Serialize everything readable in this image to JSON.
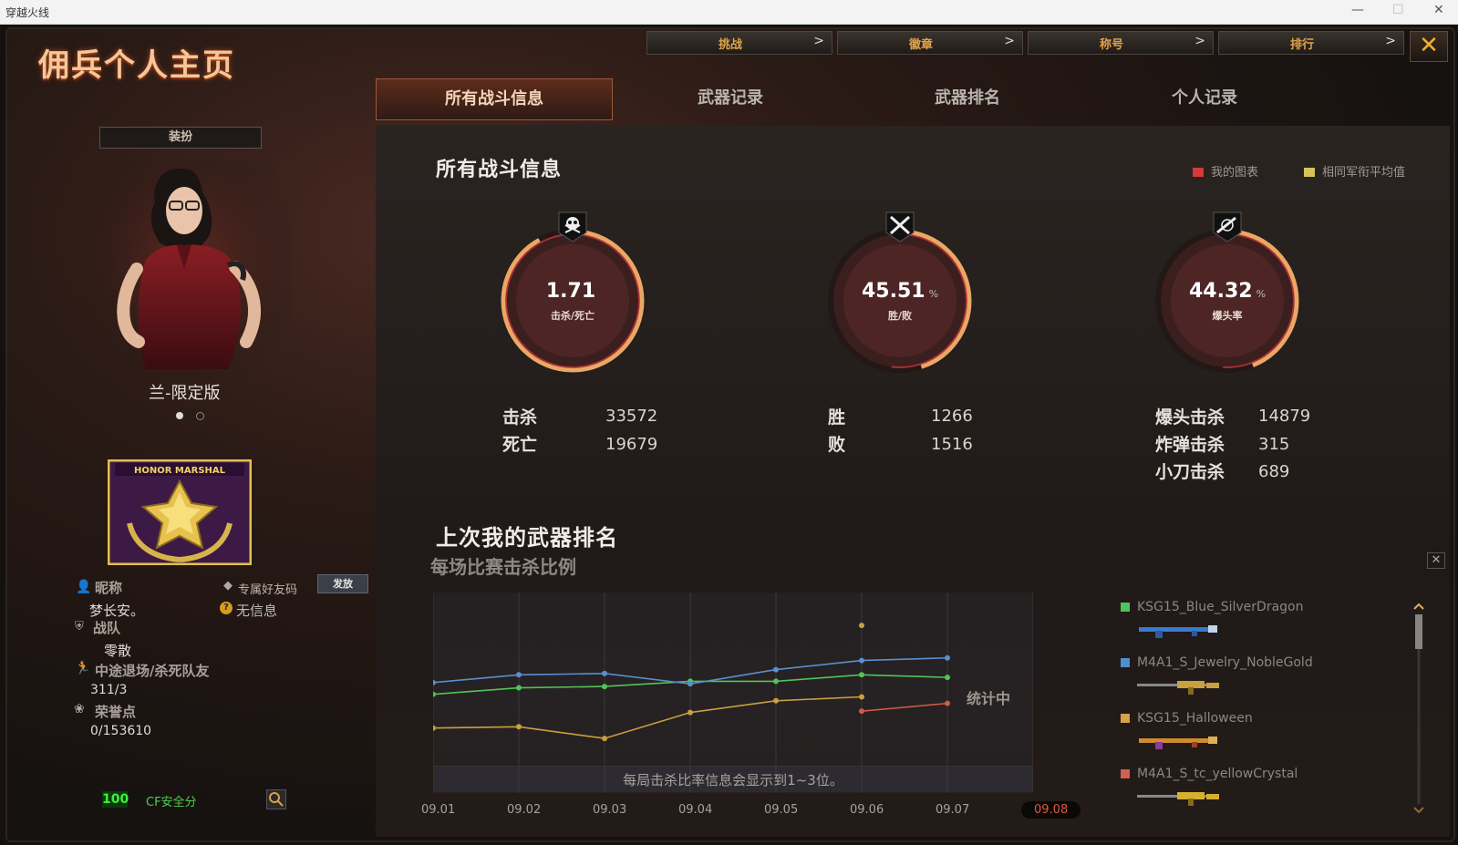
{
  "window": {
    "title": "穿越火线"
  },
  "page_title": "佣兵个人主页",
  "top_nav": [
    {
      "label": "挑战",
      "arrow": ">"
    },
    {
      "label": "徽章",
      "arrow": ">"
    },
    {
      "label": "称号",
      "arrow": ">"
    },
    {
      "label": "排行",
      "arrow": ">"
    }
  ],
  "close_icon": "✕",
  "tabs": [
    {
      "label": "所有战斗信息",
      "active": true
    },
    {
      "label": "武器记录",
      "active": false
    },
    {
      "label": "武器排名",
      "active": false
    },
    {
      "label": "个人记录",
      "active": false
    }
  ],
  "left": {
    "dress_button": "装扮",
    "character_name": "兰-限定版",
    "rank_badge_text": "HONOR MARSHAL",
    "nickname_label": "昵称",
    "nickname": "梦长安。",
    "friend_code_label": "专属好友码",
    "send_button": "发放",
    "no_info": "无信息",
    "team_label": "战队",
    "team": "零散",
    "quit_label": "中途退场/杀死队友",
    "quit_value": "311/3",
    "honor_label": "荣誉点",
    "honor_value": "0/153610",
    "safety_score": "100",
    "safety_label": "CF安全分"
  },
  "main": {
    "section_title": "所有战斗信息",
    "legend_mine": "我的图表",
    "legend_avg": "相同军衔平均值",
    "legend_mine_color": "#d7383a",
    "legend_avg_color": "#d6c25a",
    "gauges": [
      {
        "value": "1.71",
        "unit": "",
        "label": "击杀/死亡",
        "fill": 0.92,
        "icon": "skull-icon"
      },
      {
        "value": "45.51",
        "unit": "%",
        "label": "胜/败",
        "fill": 0.45,
        "icon": "crossed-swords-icon"
      },
      {
        "value": "44.32",
        "unit": "%",
        "label": "爆头率",
        "fill": 0.44,
        "icon": "rifle-icon"
      }
    ],
    "stats": {
      "kills_label": "击杀",
      "kills": "33572",
      "deaths_label": "死亡",
      "deaths": "19679",
      "wins_label": "胜",
      "wins": "1266",
      "losses_label": "败",
      "losses": "1516",
      "headshot_label": "爆头击杀",
      "headshot": "14879",
      "bomb_label": "炸弹击杀",
      "bomb": "315",
      "knife_label": "小刀击杀",
      "knife": "689"
    },
    "ranking_title": "上次我的武器排名",
    "ranking_sub": "每场比赛击杀比例",
    "chart_status": "统计中",
    "chart_note": "每局击杀比率信息会显示到1~3位。",
    "weapons": [
      {
        "name": "KSG15_Blue_SilverDragon",
        "color": "#4fc45a"
      },
      {
        "name": "M4A1_S_Jewelry_NobleGold",
        "color": "#4f8fd0"
      },
      {
        "name": "KSG15_Halloween",
        "color": "#d6a24a"
      },
      {
        "name": "M4A1_S_tc_yellowCrystal",
        "color": "#d06050"
      }
    ],
    "scroll_close": "✕"
  },
  "chart_data": {
    "type": "line",
    "x": [
      "09.01",
      "09.02",
      "09.03",
      "09.04",
      "09.05",
      "09.06",
      "09.07",
      "09.08"
    ],
    "selected_x": "09.08",
    "series": [
      {
        "name": "KSG15_Blue_SilverDragon",
        "color": "#4fc45a",
        "values": [
          0.62,
          0.67,
          0.68,
          0.72,
          0.72,
          0.77,
          0.75,
          null
        ]
      },
      {
        "name": "M4A1_S_Jewelry_NobleGold",
        "color": "#5a8fd0",
        "values": [
          0.71,
          0.77,
          0.78,
          0.7,
          0.81,
          0.88,
          0.9,
          null
        ]
      },
      {
        "name": "KSG15_Halloween",
        "color": "#c9a040",
        "values": [
          0.36,
          0.37,
          0.28,
          0.48,
          0.57,
          0.6,
          null,
          null
        ]
      },
      {
        "name": "M4A1_S_tc_yellowCrystal",
        "color": "#d05a48",
        "values": [
          null,
          null,
          null,
          null,
          null,
          0.49,
          0.55,
          null
        ]
      }
    ],
    "outlier": {
      "x": "09.06",
      "value": 1.15,
      "color": "#c9a040"
    },
    "ylim": [
      0,
      1.2
    ]
  }
}
